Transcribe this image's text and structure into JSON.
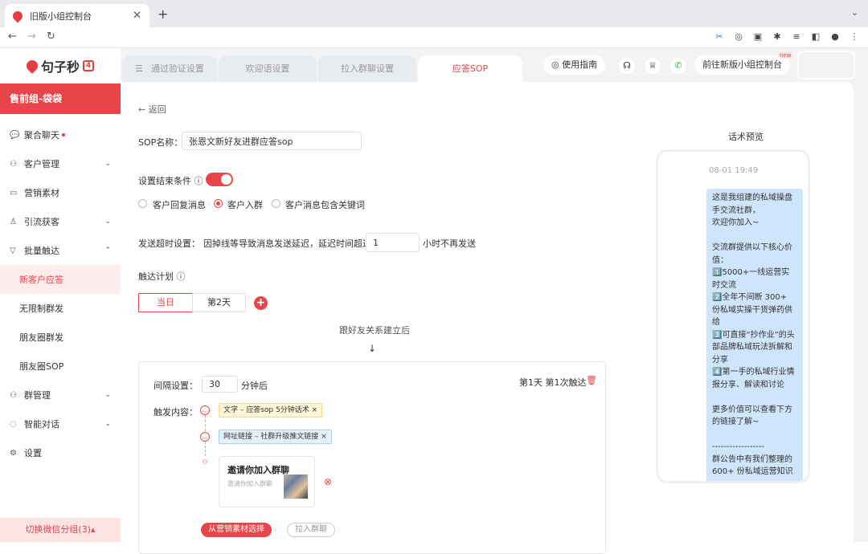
{
  "browser": {
    "tab_title": "旧版小组控制台",
    "close": "✕",
    "new_tab": "+",
    "back": "←",
    "forward": "→",
    "reload": "↻"
  },
  "sidebar": {
    "logo": "句子秒",
    "logo_box": "4",
    "group_name": "售前组-袋袋",
    "items": [
      {
        "label": "聚合聊天",
        "icon": "chat-icon"
      },
      {
        "label": "客户管理",
        "icon": "customer-icon"
      },
      {
        "label": "营销素材",
        "icon": "folder-icon"
      },
      {
        "label": "引流获客",
        "icon": "user-plus-icon"
      },
      {
        "label": "批量触达",
        "icon": "filter-icon"
      },
      {
        "label": "新客户应答"
      },
      {
        "label": "无限制群发"
      },
      {
        "label": "朋友圈群发"
      },
      {
        "label": "朋友圈SOP"
      },
      {
        "label": "群管理",
        "icon": "group-icon"
      },
      {
        "label": "智能对话",
        "icon": "bulb-icon"
      },
      {
        "label": "设置",
        "icon": "gear-icon"
      }
    ],
    "switch_label": "切换微信分组(3)▴"
  },
  "top_tabs": [
    {
      "label": "通过验证设置"
    },
    {
      "label": "欢迎语设置"
    },
    {
      "label": "拉入群聊设置"
    },
    {
      "label": "应答SOP"
    }
  ],
  "top_bar": {
    "guide": "使用指南",
    "new_console": "前往新版小组控制台",
    "new_badge": "new"
  },
  "form": {
    "back": "返回",
    "sop_name_label": "SOP名称：",
    "sop_name_value": "张恩文新好友进群应答sop",
    "end_condition_label": "设置结束条件",
    "radios": [
      "客户回复消息",
      "客户入群",
      "客户消息包含关键词"
    ],
    "timeout_label": "发送超时设置：",
    "timeout_desc": "因掉线等导致消息发送延迟，延迟时间超过",
    "timeout_value": "1",
    "timeout_suffix": "小时不再发送",
    "plan_label": "触达计划",
    "day_tabs": [
      "当日",
      "第2天"
    ],
    "flow_text": "跟好友关系建立后",
    "interval_label": "间隔设置：",
    "interval_value": "30",
    "interval_unit": "分钟后",
    "trigger_info": "第1天 第1次触达",
    "content_label": "触发内容：",
    "chip1": "文字 – 应答sop 5分钟话术 ×",
    "chip2": "网址链接 – 社群升级推文链接 ×",
    "invite_title": "邀请你加入群聊",
    "invite_sub": "邀请你加入群聊",
    "btn_material": "从营销素材选择",
    "btn_group": "拉入群聊"
  },
  "preview": {
    "title": "话术预览",
    "time": "08-01 19:49",
    "message": "这是我组建的私域操盘手交流社群，\n欢迎你加入~\n\n交流群提供以下核心价值：\n1️⃣5000+一线运营实时交流\n2️⃣全年不间断 300+ 份私域实操干货弹药供给\n3️⃣可直接“抄作业”的头部品牌私域玩法拆解和分享\n4️⃣第一手的私域行业情报分享、解读和讨论\n\n更多价值可以查看下方的链接了解~\n\n------------------\n群公告中有我们整理的 600+ 份私域运营知识"
  },
  "colors": {
    "accent": "#e8454a",
    "bubble": "#cfe5fb"
  }
}
